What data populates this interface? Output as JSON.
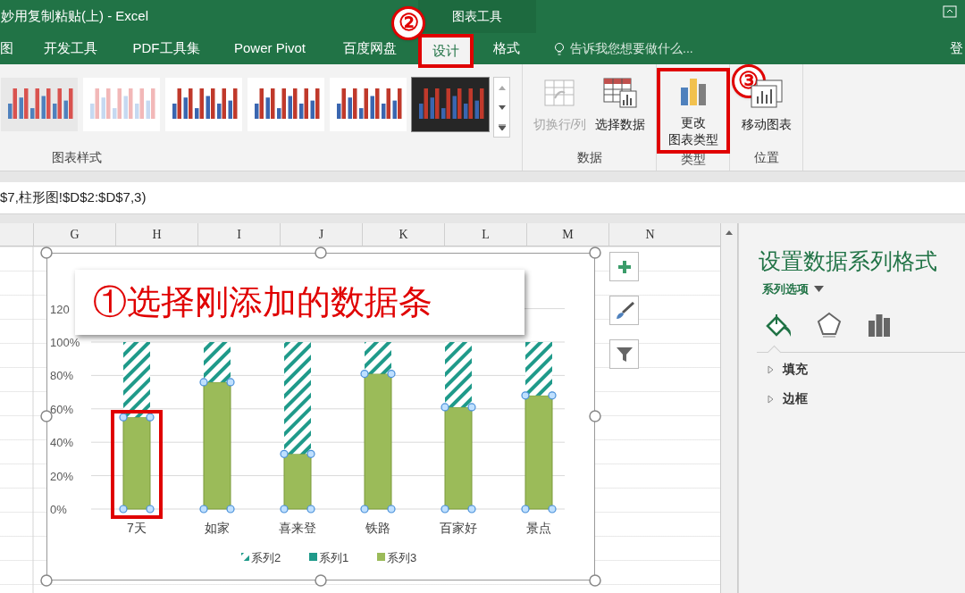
{
  "window": {
    "title": "妙用复制粘贴(上) - Excel",
    "context_group": "图表工具",
    "account": "登"
  },
  "ribbon_tabs": [
    {
      "label": "图",
      "selected": false,
      "highlighted": false
    },
    {
      "label": "开发工具",
      "selected": false,
      "highlighted": false
    },
    {
      "label": "PDF工具集",
      "selected": false,
      "highlighted": false
    },
    {
      "label": "Power Pivot",
      "selected": false,
      "highlighted": false
    },
    {
      "label": "百度网盘",
      "selected": false,
      "highlighted": false
    },
    {
      "label": "设计",
      "selected": true,
      "highlighted": true,
      "marker": "②"
    },
    {
      "label": "格式",
      "selected": false,
      "highlighted": false
    }
  ],
  "tell_me": {
    "placeholder": "告诉我您想要做什么..."
  },
  "ribbon": {
    "gallery": {
      "label": "图表样式"
    },
    "groups": [
      {
        "label": "数据",
        "buttons": [
          {
            "kind": "switch",
            "lines": [
              "切换行/列"
            ],
            "disabled": true,
            "highlighted": false
          },
          {
            "kind": "select",
            "lines": [
              "选择数据"
            ],
            "disabled": false,
            "highlighted": false
          }
        ]
      },
      {
        "label": "类型",
        "buttons": [
          {
            "kind": "change",
            "lines": [
              "更改",
              "图表类型"
            ],
            "disabled": false,
            "highlighted": true,
            "marker": "③"
          }
        ]
      },
      {
        "label": "位置",
        "buttons": [
          {
            "kind": "move",
            "lines": [
              "移动图表"
            ],
            "disabled": false,
            "highlighted": false
          }
        ]
      }
    ]
  },
  "formula_bar": {
    "value": "$7,柱形图!$D$2:$D$7,3)"
  },
  "sheet": {
    "columns": [
      "G",
      "H",
      "I",
      "J",
      "K",
      "L",
      "M",
      "N"
    ]
  },
  "chart": {
    "selected": true,
    "callout": "①选择刚添加的数据条",
    "highlighted_bars": [
      true,
      false,
      false,
      false,
      false,
      false
    ],
    "series_hatched": [
      false,
      false,
      true
    ],
    "selected_series": [
      true,
      false,
      false
    ],
    "chart_data": {
      "type": "bar",
      "stacked": true,
      "grid": true,
      "legend": "bottom",
      "ylim": [
        0,
        120
      ],
      "categories": [
        "7天",
        "如家",
        "喜来登",
        "铁路",
        "百家好",
        "景点"
      ],
      "yticks": [
        {
          "value": 0,
          "label": "0%"
        },
        {
          "value": 20,
          "label": "20%"
        },
        {
          "value": 40,
          "label": "40%"
        },
        {
          "value": 60,
          "label": "60%"
        },
        {
          "value": 80,
          "label": "80%"
        },
        {
          "value": 100,
          "label": "100%"
        },
        {
          "value": 120,
          "label": "120"
        }
      ],
      "series": [
        {
          "name": "系列3",
          "color": "#9bbb59",
          "values": [
            55,
            76,
            33,
            81,
            61,
            68
          ]
        },
        {
          "name": "系列1",
          "color": "#1f9a8a",
          "values": [
            0,
            0,
            0,
            0,
            0,
            0
          ]
        },
        {
          "name": "系列2",
          "color": "#1f9a8a",
          "values": [
            45,
            24,
            67,
            19,
            39,
            32
          ]
        }
      ]
    }
  },
  "format_pane": {
    "title": "设置数据系列格式",
    "options": "系列选项",
    "tabs": [
      {
        "kind": "fill",
        "selected": true
      },
      {
        "kind": "effects",
        "selected": false
      },
      {
        "kind": "series",
        "selected": false
      }
    ],
    "sections": [
      {
        "label": "填充",
        "expanded": false
      },
      {
        "label": "边框",
        "expanded": false
      }
    ]
  }
}
